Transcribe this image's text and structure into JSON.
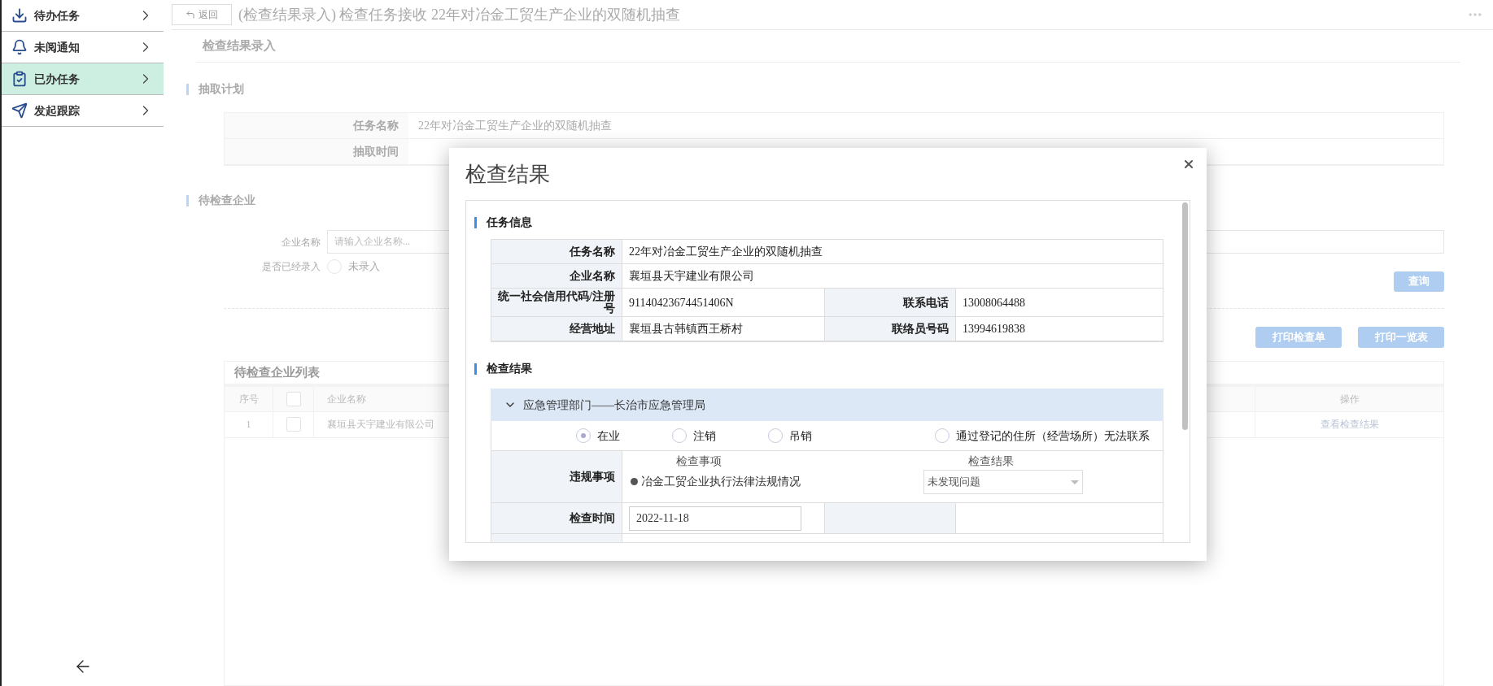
{
  "sidebar": {
    "items": [
      {
        "label": "待办任务",
        "selected": false
      },
      {
        "label": "未阅通知",
        "selected": false
      },
      {
        "label": "已办任务",
        "selected": true
      },
      {
        "label": "发起跟踪",
        "selected": false
      }
    ]
  },
  "header": {
    "back_button": "返回",
    "title": "(检查结果录入) 检查任务接收 22年对冶金工贸生产企业的双随机抽查"
  },
  "page": {
    "heading": "检查结果录入",
    "plan": {
      "title": "抽取计划",
      "rows": [
        {
          "label": "任务名称",
          "value": "22年对冶金工贸生产企业的双随机抽查"
        },
        {
          "label": "抽取时间"
        }
      ]
    },
    "companies": {
      "title": "待检查企业",
      "name_field": {
        "label": "企业名称",
        "placeholder": "请输入企业名称..."
      },
      "entered_filter": {
        "label": "是否已经录入",
        "options": [
          {
            "label": "未录入",
            "selected": false
          }
        ]
      },
      "query_button": "查询",
      "print_buttons": [
        "打印检查单",
        "打印一览表"
      ],
      "list": {
        "title": "待检查企业列表",
        "columns": [
          "序号",
          "企业名称",
          "操作"
        ],
        "header_checked": false,
        "rows": [
          {
            "index": "1",
            "checked": false,
            "name": "襄垣县天宇建业有限公司",
            "action": "查看检查结果"
          }
        ]
      }
    }
  },
  "modal": {
    "title": "检查结果",
    "task_info": {
      "title": "任务信息",
      "rows": [
        [
          {
            "label": "任务名称",
            "value": "22年对冶金工贸生产企业的双随机抽查"
          }
        ],
        [
          {
            "label": "企业名称",
            "value": "襄垣县天宇建业有限公司"
          }
        ],
        [
          {
            "label": "统一社会信用代码/注册号",
            "value": "91140423674451406N"
          },
          {
            "label": "联系电话",
            "value": "13008064488"
          }
        ],
        [
          {
            "label": "经营地址",
            "value": "襄垣县古韩镇西王桥村"
          },
          {
            "label": "联络员号码",
            "value": "13994619838"
          }
        ]
      ]
    },
    "result": {
      "title": "检查结果",
      "department": {
        "label": "应急管理部门——长治市应急管理局",
        "expanded": true
      },
      "status_options": [
        {
          "label": "在业",
          "selected": true
        },
        {
          "label": "注销",
          "selected": false
        },
        {
          "label": "吊销",
          "selected": false
        },
        {
          "label": "通过登记的住所（经营场所）无法联系",
          "selected": false
        }
      ],
      "violation": {
        "label": "违规事项",
        "item_heading": "检查事项",
        "result_heading": "检查结果",
        "items": [
          {
            "item": "冶金工贸企业执行法律法规情况",
            "result": "未发现问题"
          }
        ]
      },
      "date": {
        "label": "检查时间",
        "value": "2022-11-18"
      }
    }
  }
}
